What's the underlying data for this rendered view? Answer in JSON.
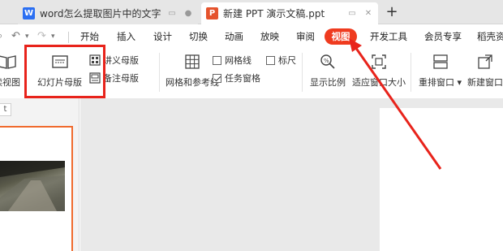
{
  "tabs": [
    {
      "title": "word怎么提取图片中的文字",
      "icon": "word-doc-icon",
      "icon_letter": "W"
    },
    {
      "title": "新建 PPT 演示文稿.ppt",
      "icon": "ppt-doc-icon",
      "icon_letter": "P"
    }
  ],
  "new_tab_label": "+",
  "menu": {
    "items": [
      "开始",
      "插入",
      "设计",
      "切换",
      "动画",
      "放映",
      "审阅",
      "视图",
      "开发工具",
      "会员专享",
      "稻壳资"
    ],
    "active": "视图"
  },
  "ribbon": {
    "reading_view": "读视图",
    "slide_master": "幻灯片母版",
    "handout_master": "讲义母版",
    "notes_master": "备注母版",
    "grid_guides": "网格和参考线",
    "gridlines": "网格线",
    "ruler": "标尺",
    "task_pane": "任务窗格",
    "zoom": "显示比例",
    "fit_window": "适应窗口大小",
    "rearrange": "重排窗口",
    "new_window": "新建窗口"
  },
  "checkboxes": {
    "gridlines": false,
    "ruler": false,
    "task_pane": true
  },
  "left_panel": {
    "tab_label": "t"
  },
  "colors": {
    "accent": "#ef3b1f",
    "annotation": "#e8231b",
    "selection": "#f06b2e"
  }
}
